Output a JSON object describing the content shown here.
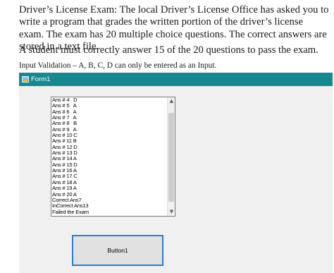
{
  "question": {
    "paragraph1": "Driver’s License Exam: The local Driver’s License Office has asked you to write a program that grades the written portion of the driver’s license exam. The exam has 20 multiple choice questions. The correct answers are stored in a text file.",
    "paragraph2": "A student must correctly answer 15 of the 20 questions to pass the exam.",
    "note": "Input Validation – A, B, C, D can only be entered as an Input."
  },
  "form": {
    "title": "Form1",
    "title_bar_color": "#17888f",
    "icon": "form-app-icon",
    "listbox": {
      "items": [
        "Ans # 4   D",
        "Ans # 5   A",
        "Ans # 6   A",
        "Ans # 7   A",
        "Ans # 8   B",
        "Ans # 9   A",
        "Ans # 10 C",
        "Ans # 11 B",
        "Ans # 12 D",
        "Ans # 13 D",
        "Ans # 14 A",
        "Ans # 15 D",
        "Ans # 16 A",
        "Ans # 17 C",
        "Ans # 18 A",
        "Ans # 19 A",
        "Ans # 20 A",
        "Correct Ans7",
        "InCorrect Ans13",
        "Failed the Exam"
      ],
      "scroll_up_icon": "chevron-up-icon",
      "scroll_down_icon": "chevron-down-icon"
    },
    "button_label": "Button1",
    "button_border_color": "#2a7ccd"
  }
}
